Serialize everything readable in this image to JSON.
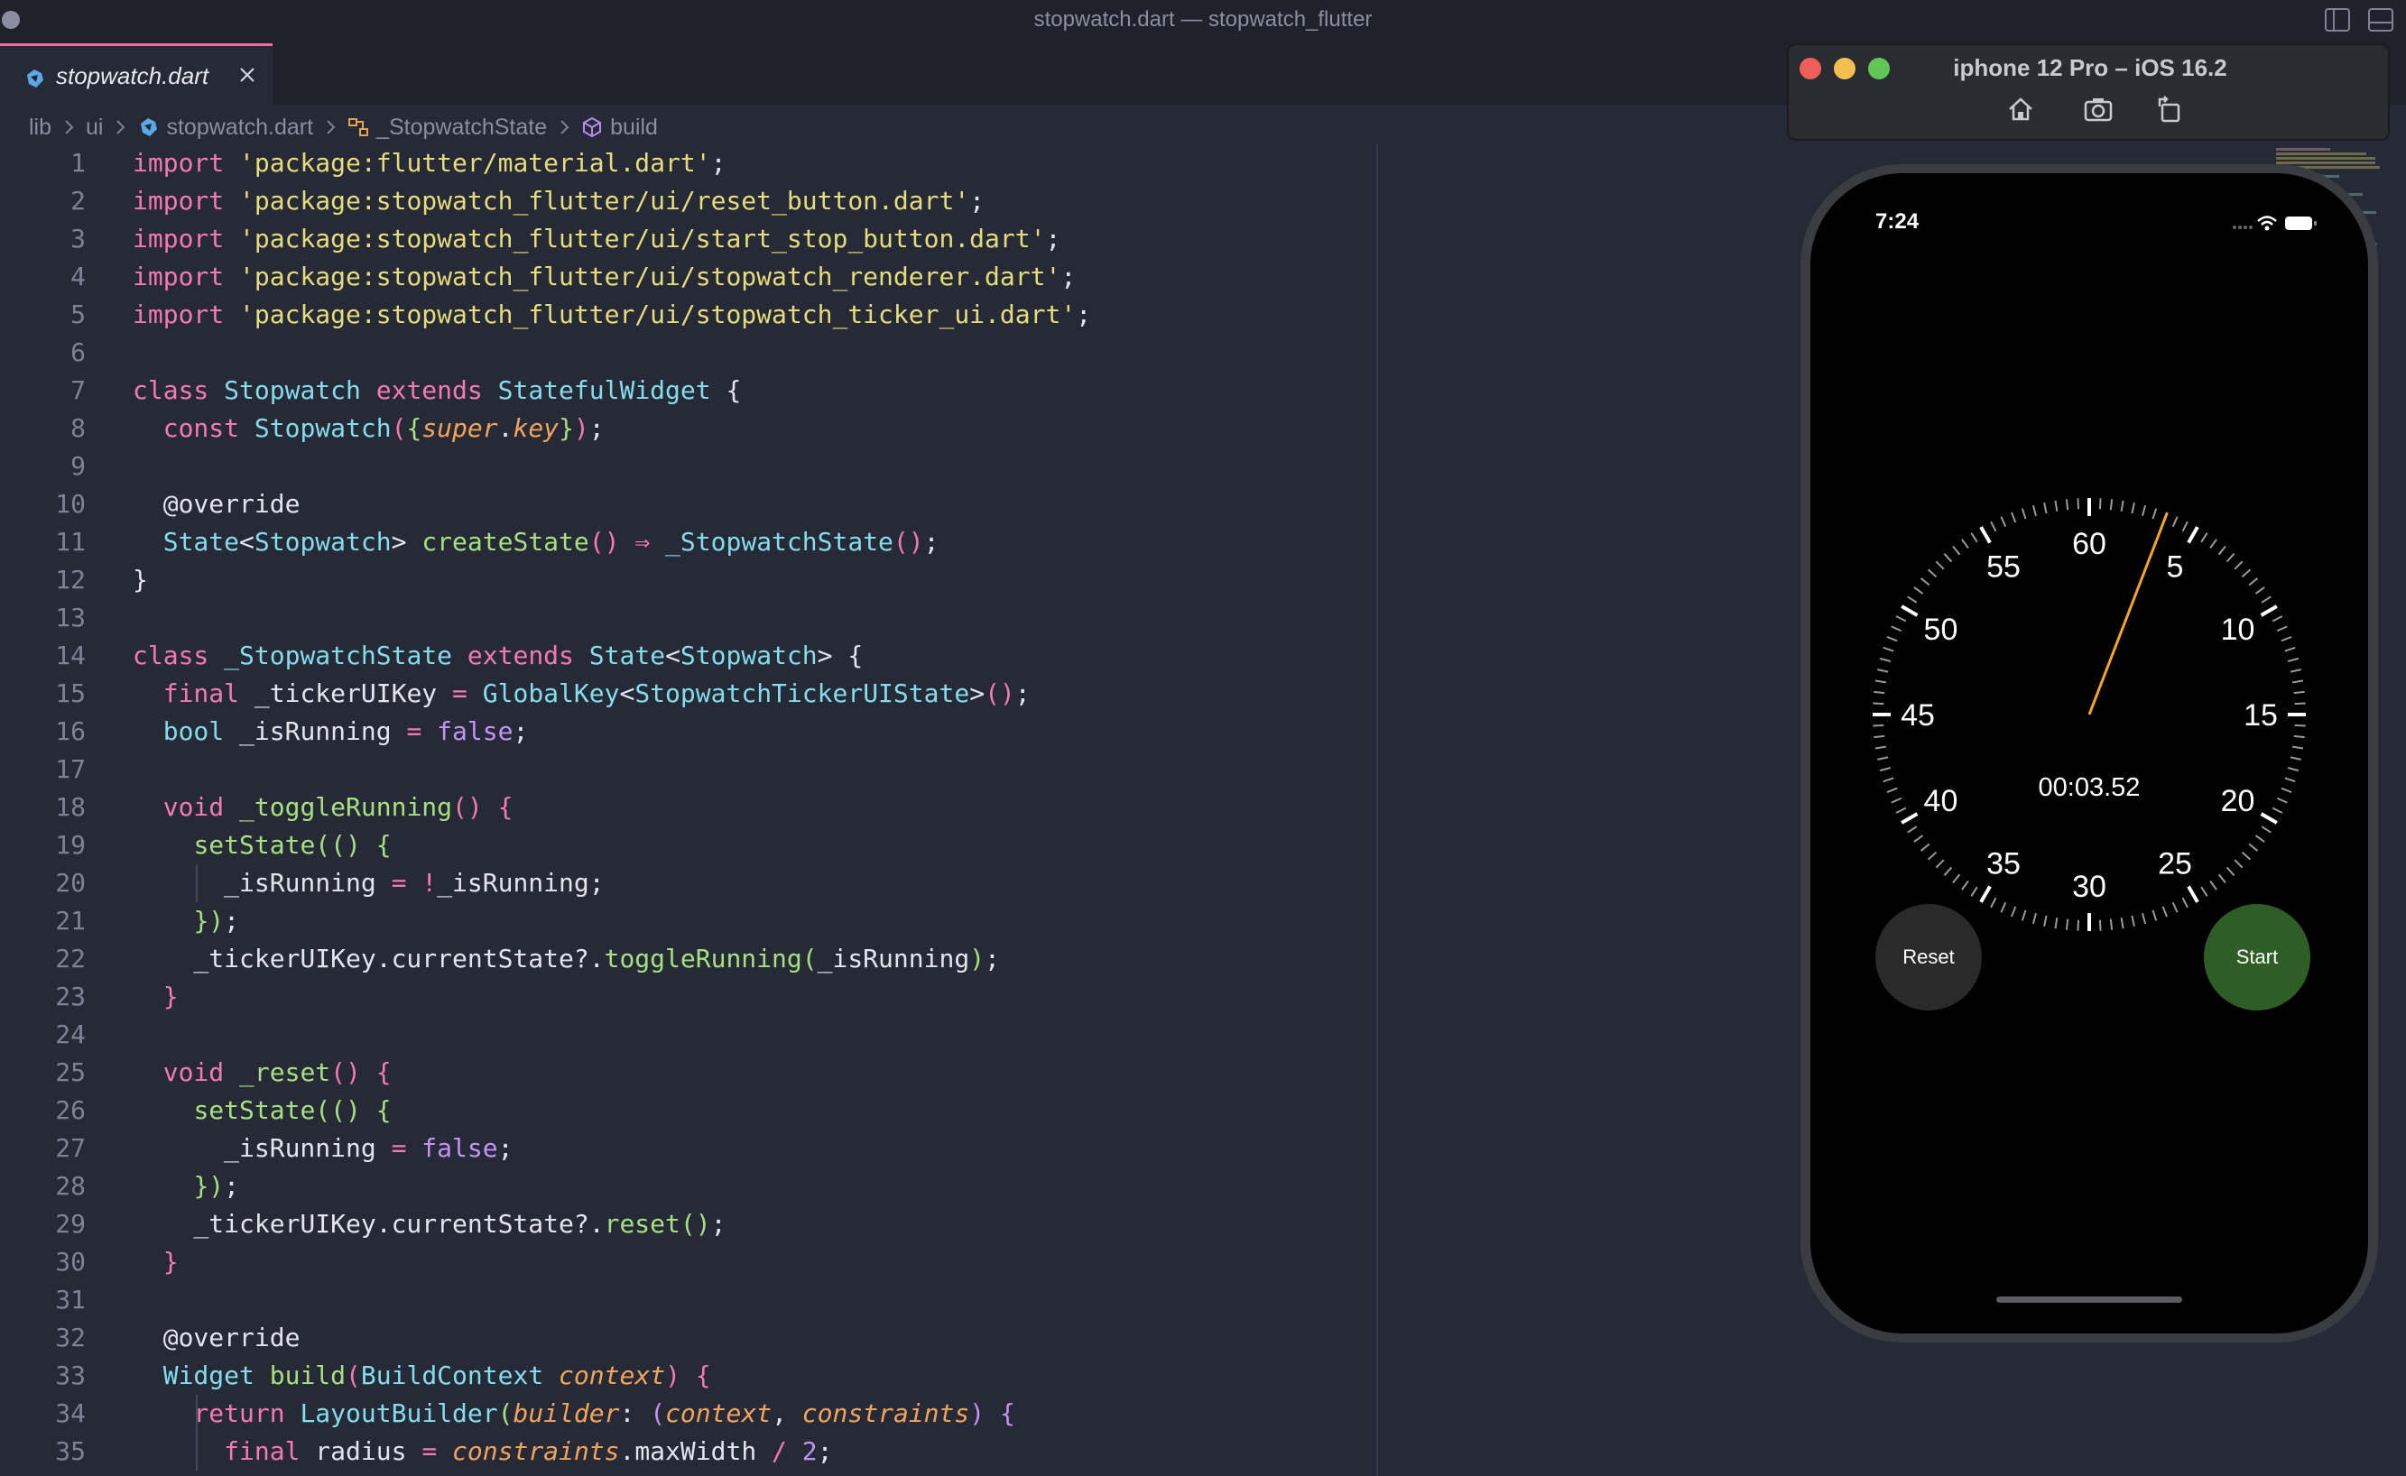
{
  "window": {
    "title": "stopwatch.dart — stopwatch_flutter"
  },
  "tabs": [
    {
      "label": "stopwatch.dart",
      "active": true,
      "icon": "dart-icon"
    }
  ],
  "breadcrumb": {
    "items": [
      "lib",
      "ui",
      "stopwatch.dart",
      "_StopwatchState",
      "build"
    ]
  },
  "editor": {
    "lines": [
      {
        "n": "1",
        "tokens": [
          [
            "import",
            "tok-import"
          ],
          [
            " ",
            "tok-plain"
          ],
          [
            "'package:flutter/material.dart'",
            "tok-str"
          ],
          [
            ";",
            "tok-punct"
          ]
        ]
      },
      {
        "n": "2",
        "tokens": [
          [
            "import",
            "tok-import"
          ],
          [
            " ",
            "tok-plain"
          ],
          [
            "'package:stopwatch_flutter/ui/reset_button.dart'",
            "tok-str"
          ],
          [
            ";",
            "tok-punct"
          ]
        ]
      },
      {
        "n": "3",
        "tokens": [
          [
            "import",
            "tok-import"
          ],
          [
            " ",
            "tok-plain"
          ],
          [
            "'package:stopwatch_flutter/ui/start_stop_button.dart'",
            "tok-str"
          ],
          [
            ";",
            "tok-punct"
          ]
        ]
      },
      {
        "n": "4",
        "tokens": [
          [
            "import",
            "tok-import"
          ],
          [
            " ",
            "tok-plain"
          ],
          [
            "'package:stopwatch_flutter/ui/stopwatch_renderer.dart'",
            "tok-str"
          ],
          [
            ";",
            "tok-punct"
          ]
        ]
      },
      {
        "n": "5",
        "tokens": [
          [
            "import",
            "tok-import"
          ],
          [
            " ",
            "tok-plain"
          ],
          [
            "'package:stopwatch_flutter/ui/stopwatch_ticker_ui.dart'",
            "tok-str"
          ],
          [
            ";",
            "tok-punct"
          ]
        ]
      },
      {
        "n": "6",
        "tokens": []
      },
      {
        "n": "7",
        "tokens": [
          [
            "class",
            "tok-class"
          ],
          [
            " ",
            "tok-plain"
          ],
          [
            "Stopwatch",
            "tok-type"
          ],
          [
            " ",
            "tok-plain"
          ],
          [
            "extends",
            "tok-extends"
          ],
          [
            " ",
            "tok-plain"
          ],
          [
            "StatefulWidget",
            "tok-type"
          ],
          [
            " {",
            "tok-punct"
          ]
        ]
      },
      {
        "n": "8",
        "tokens": [
          [
            "  ",
            "tok-plain"
          ],
          [
            "const",
            "tok-const"
          ],
          [
            " ",
            "tok-plain"
          ],
          [
            "Stopwatch",
            "tok-type"
          ],
          [
            "(",
            "tok-br1"
          ],
          [
            "{",
            "tok-br2"
          ],
          [
            "super",
            "tok-italic"
          ],
          [
            ".",
            "tok-punct"
          ],
          [
            "key",
            "tok-italic"
          ],
          [
            "}",
            "tok-br2"
          ],
          [
            ")",
            "tok-br1"
          ],
          [
            ";",
            "tok-punct"
          ]
        ]
      },
      {
        "n": "9",
        "tokens": []
      },
      {
        "n": "10",
        "tokens": [
          [
            "  @override",
            "tok-plain"
          ]
        ]
      },
      {
        "n": "11",
        "tokens": [
          [
            "  ",
            "tok-plain"
          ],
          [
            "State",
            "tok-type"
          ],
          [
            "<",
            "tok-punct"
          ],
          [
            "Stopwatch",
            "tok-type"
          ],
          [
            "> ",
            "tok-punct"
          ],
          [
            "createState",
            "tok-fn"
          ],
          [
            "()",
            "tok-br1"
          ],
          [
            " ",
            "tok-plain"
          ],
          [
            "⇒",
            "tok-op"
          ],
          [
            " ",
            "tok-plain"
          ],
          [
            "_StopwatchState",
            "tok-type"
          ],
          [
            "()",
            "tok-br1"
          ],
          [
            ";",
            "tok-punct"
          ]
        ]
      },
      {
        "n": "12",
        "tokens": [
          [
            "}",
            "tok-punct"
          ]
        ]
      },
      {
        "n": "13",
        "tokens": []
      },
      {
        "n": "14",
        "tokens": [
          [
            "class",
            "tok-class"
          ],
          [
            " ",
            "tok-plain"
          ],
          [
            "_StopwatchState",
            "tok-type"
          ],
          [
            " ",
            "tok-plain"
          ],
          [
            "extends",
            "tok-extends"
          ],
          [
            " ",
            "tok-plain"
          ],
          [
            "State",
            "tok-type"
          ],
          [
            "<",
            "tok-punct"
          ],
          [
            "Stopwatch",
            "tok-type"
          ],
          [
            "> {",
            "tok-punct"
          ]
        ]
      },
      {
        "n": "15",
        "tokens": [
          [
            "  ",
            "tok-plain"
          ],
          [
            "final",
            "tok-final"
          ],
          [
            " _tickerUIKey ",
            "tok-plain"
          ],
          [
            "=",
            "tok-op"
          ],
          [
            " ",
            "tok-plain"
          ],
          [
            "GlobalKey",
            "tok-type"
          ],
          [
            "<",
            "tok-punct"
          ],
          [
            "StopwatchTickerUIState",
            "tok-type"
          ],
          [
            ">",
            "tok-punct"
          ],
          [
            "()",
            "tok-br1"
          ],
          [
            ";",
            "tok-punct"
          ]
        ]
      },
      {
        "n": "16",
        "tokens": [
          [
            "  ",
            "tok-plain"
          ],
          [
            "bool",
            "tok-type"
          ],
          [
            " _isRunning ",
            "tok-plain"
          ],
          [
            "=",
            "tok-op"
          ],
          [
            " ",
            "tok-plain"
          ],
          [
            "false",
            "tok-kw2"
          ],
          [
            ";",
            "tok-punct"
          ]
        ]
      },
      {
        "n": "17",
        "tokens": []
      },
      {
        "n": "18",
        "tokens": [
          [
            "  ",
            "tok-plain"
          ],
          [
            "void",
            "tok-void"
          ],
          [
            " ",
            "tok-plain"
          ],
          [
            "_toggleRunning",
            "tok-fn"
          ],
          [
            "() {",
            "tok-br1"
          ]
        ]
      },
      {
        "n": "19",
        "tokens": [
          [
            "    ",
            "tok-plain"
          ],
          [
            "setState",
            "tok-fn"
          ],
          [
            "(() {",
            "tok-br2"
          ]
        ]
      },
      {
        "n": "20",
        "tokens": [
          [
            "      _isRunning ",
            "tok-plain"
          ],
          [
            "=",
            "tok-op"
          ],
          [
            " ",
            "tok-plain"
          ],
          [
            "!",
            "tok-op"
          ],
          [
            "_isRunning;",
            "tok-plain"
          ]
        ]
      },
      {
        "n": "21",
        "tokens": [
          [
            "    ",
            "tok-plain"
          ],
          [
            "})",
            "tok-br2"
          ],
          [
            ";",
            "tok-punct"
          ]
        ]
      },
      {
        "n": "22",
        "tokens": [
          [
            "    _tickerUIKey.currentState",
            "tok-plain"
          ],
          [
            "?.",
            "tok-plain"
          ],
          [
            "toggleRunning",
            "tok-fn"
          ],
          [
            "(",
            "tok-br2"
          ],
          [
            "_isRunning",
            "tok-plain"
          ],
          [
            ")",
            "tok-br2"
          ],
          [
            ";",
            "tok-punct"
          ]
        ]
      },
      {
        "n": "23",
        "tokens": [
          [
            "  ",
            "tok-plain"
          ],
          [
            "}",
            "tok-br1"
          ]
        ]
      },
      {
        "n": "24",
        "tokens": []
      },
      {
        "n": "25",
        "tokens": [
          [
            "  ",
            "tok-plain"
          ],
          [
            "void",
            "tok-void"
          ],
          [
            " ",
            "tok-plain"
          ],
          [
            "_reset",
            "tok-fn"
          ],
          [
            "() {",
            "tok-br1"
          ]
        ]
      },
      {
        "n": "26",
        "tokens": [
          [
            "    ",
            "tok-plain"
          ],
          [
            "setState",
            "tok-fn"
          ],
          [
            "(() {",
            "tok-br2"
          ]
        ]
      },
      {
        "n": "27",
        "tokens": [
          [
            "      _isRunning ",
            "tok-plain"
          ],
          [
            "=",
            "tok-op"
          ],
          [
            " ",
            "tok-plain"
          ],
          [
            "false",
            "tok-kw2"
          ],
          [
            ";",
            "tok-punct"
          ]
        ]
      },
      {
        "n": "28",
        "tokens": [
          [
            "    ",
            "tok-plain"
          ],
          [
            "})",
            "tok-br2"
          ],
          [
            ";",
            "tok-punct"
          ]
        ]
      },
      {
        "n": "29",
        "tokens": [
          [
            "    _tickerUIKey.currentState",
            "tok-plain"
          ],
          [
            "?.",
            "tok-plain"
          ],
          [
            "reset",
            "tok-fn"
          ],
          [
            "()",
            "tok-br2"
          ],
          [
            ";",
            "tok-punct"
          ]
        ]
      },
      {
        "n": "30",
        "tokens": [
          [
            "  ",
            "tok-plain"
          ],
          [
            "}",
            "tok-br1"
          ]
        ]
      },
      {
        "n": "31",
        "tokens": []
      },
      {
        "n": "32",
        "tokens": [
          [
            "  @override",
            "tok-plain"
          ]
        ]
      },
      {
        "n": "33",
        "tokens": [
          [
            "  ",
            "tok-plain"
          ],
          [
            "Widget",
            "tok-type"
          ],
          [
            " ",
            "tok-plain"
          ],
          [
            "build",
            "tok-fn"
          ],
          [
            "(",
            "tok-br1"
          ],
          [
            "BuildContext",
            "tok-type"
          ],
          [
            " ",
            "tok-plain"
          ],
          [
            "context",
            "tok-italic"
          ],
          [
            ") {",
            "tok-br1"
          ]
        ]
      },
      {
        "n": "34",
        "tokens": [
          [
            "    ",
            "tok-plain"
          ],
          [
            "return",
            "tok-return"
          ],
          [
            " ",
            "tok-plain"
          ],
          [
            "LayoutBuilder",
            "tok-type"
          ],
          [
            "(",
            "tok-br2"
          ],
          [
            "builder",
            "tok-italic"
          ],
          [
            ": ",
            "tok-punct"
          ],
          [
            "(",
            "tok-br3"
          ],
          [
            "context",
            "tok-italic"
          ],
          [
            ", ",
            "tok-punct"
          ],
          [
            "constraints",
            "tok-italic"
          ],
          [
            ") {",
            "tok-br3"
          ]
        ]
      },
      {
        "n": "35",
        "tokens": [
          [
            "      ",
            "tok-plain"
          ],
          [
            "final",
            "tok-final"
          ],
          [
            " radius ",
            "tok-plain"
          ],
          [
            "=",
            "tok-op"
          ],
          [
            " ",
            "tok-plain"
          ],
          [
            "constraints",
            "tok-italic"
          ],
          [
            ".maxWidth ",
            "tok-plain"
          ],
          [
            "/",
            "tok-op"
          ],
          [
            " ",
            "tok-plain"
          ],
          [
            "2",
            "tok-num"
          ],
          [
            ";",
            "tok-punct"
          ]
        ]
      }
    ]
  },
  "simulator": {
    "title": "iphone 12 Pro – iOS 16.2",
    "toolbar_icons": [
      "home-icon",
      "screenshot-icon",
      "rotate-icon"
    ],
    "status_time": "7:24",
    "stopwatch": {
      "elapsed": "00:03.52",
      "dial_labels": [
        "60",
        "5",
        "10",
        "15",
        "20",
        "25",
        "30",
        "35",
        "40",
        "45",
        "50",
        "55"
      ],
      "hand_seconds": 3.52,
      "hand_color": "#f5a623",
      "reset_label": "Reset",
      "start_label": "Start",
      "reset_color": "#2a2a2a",
      "start_color": "#2e5e25"
    }
  },
  "colors": {
    "editor_bg": "#262a36",
    "accent_tab": "#f06c9b"
  }
}
